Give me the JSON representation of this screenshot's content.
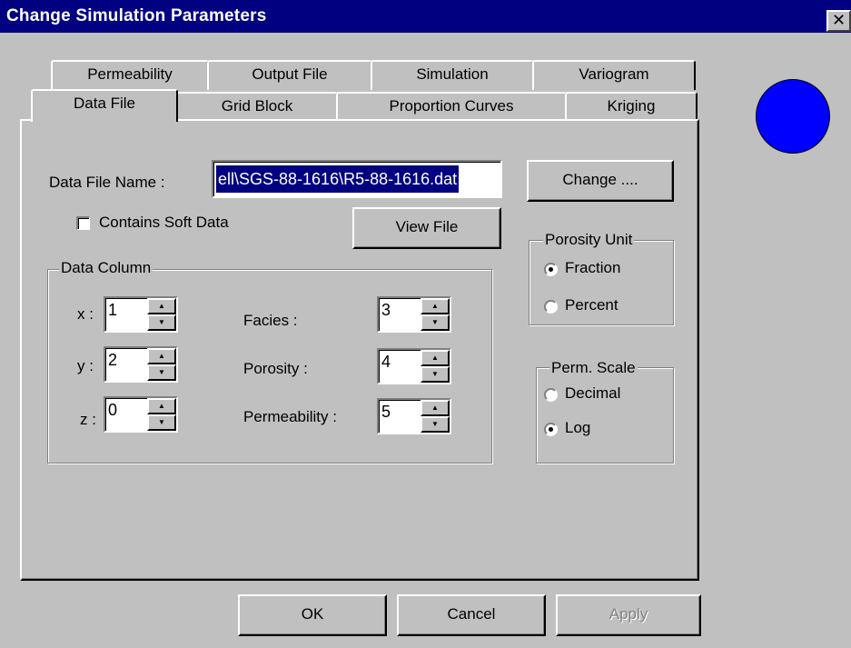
{
  "window": {
    "title": "Change Simulation Parameters",
    "close_glyph": "✕"
  },
  "tabs": {
    "row_back": [
      "Permeability",
      "Output File",
      "Simulation",
      "Variogram"
    ],
    "row_front": [
      "Data File",
      "Grid Block",
      "Proportion Curves",
      "Kriging"
    ],
    "active": "Data File"
  },
  "data_file": {
    "name_label": "Data File Name :",
    "name_value": "ell\\SGS-88-1616\\R5-88-1616.dat",
    "change_button": "Change ....",
    "soft_data_label": "Contains Soft Data",
    "soft_data_checked": false,
    "view_file_button": "View File"
  },
  "data_column": {
    "title": "Data Column",
    "x_label": "x :",
    "x_value": "1",
    "y_label": "y :",
    "y_value": "2",
    "z_label": "z :",
    "z_value": "0",
    "facies_label": "Facies :",
    "facies_value": "3",
    "porosity_label": "Porosity :",
    "porosity_value": "4",
    "permeability_label": "Permeability :",
    "permeability_value": "5"
  },
  "porosity_unit": {
    "title": "Porosity Unit",
    "options": [
      "Fraction",
      "Percent"
    ],
    "selected": "Fraction"
  },
  "perm_scale": {
    "title": "Perm. Scale",
    "options": [
      "Decimal",
      "Log"
    ],
    "selected": "Log"
  },
  "footer": {
    "ok": "OK",
    "cancel": "Cancel",
    "apply": "Apply",
    "apply_enabled": false
  },
  "indicator": {
    "color": "#0000ff"
  }
}
